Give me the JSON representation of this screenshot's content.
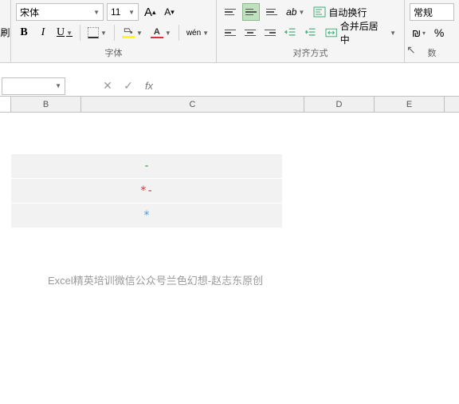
{
  "ribbon": {
    "font": {
      "name": "宋体",
      "size": "11",
      "increase": "A",
      "decrease": "A",
      "bold": "B",
      "italic": "I",
      "underline": "U",
      "wen": "wén",
      "group_label": "字体"
    },
    "align": {
      "wrap": "自动换行",
      "merge": "合并后居中",
      "group_label": "对齐方式"
    },
    "number": {
      "format": "常规",
      "percent": "%",
      "group_label": "数"
    },
    "brush": "刷"
  },
  "formula_bar": {
    "cancel": "✕",
    "confirm": "✓",
    "fx": "fx",
    "value": ""
  },
  "columns": {
    "B": "B",
    "C": "C",
    "D": "D",
    "E": "E"
  },
  "cells": {
    "r1": "-",
    "r2": "*-",
    "r3": "*"
  },
  "attribution": "Excel精英培训微信公众号兰色幻想-赵志东原创"
}
